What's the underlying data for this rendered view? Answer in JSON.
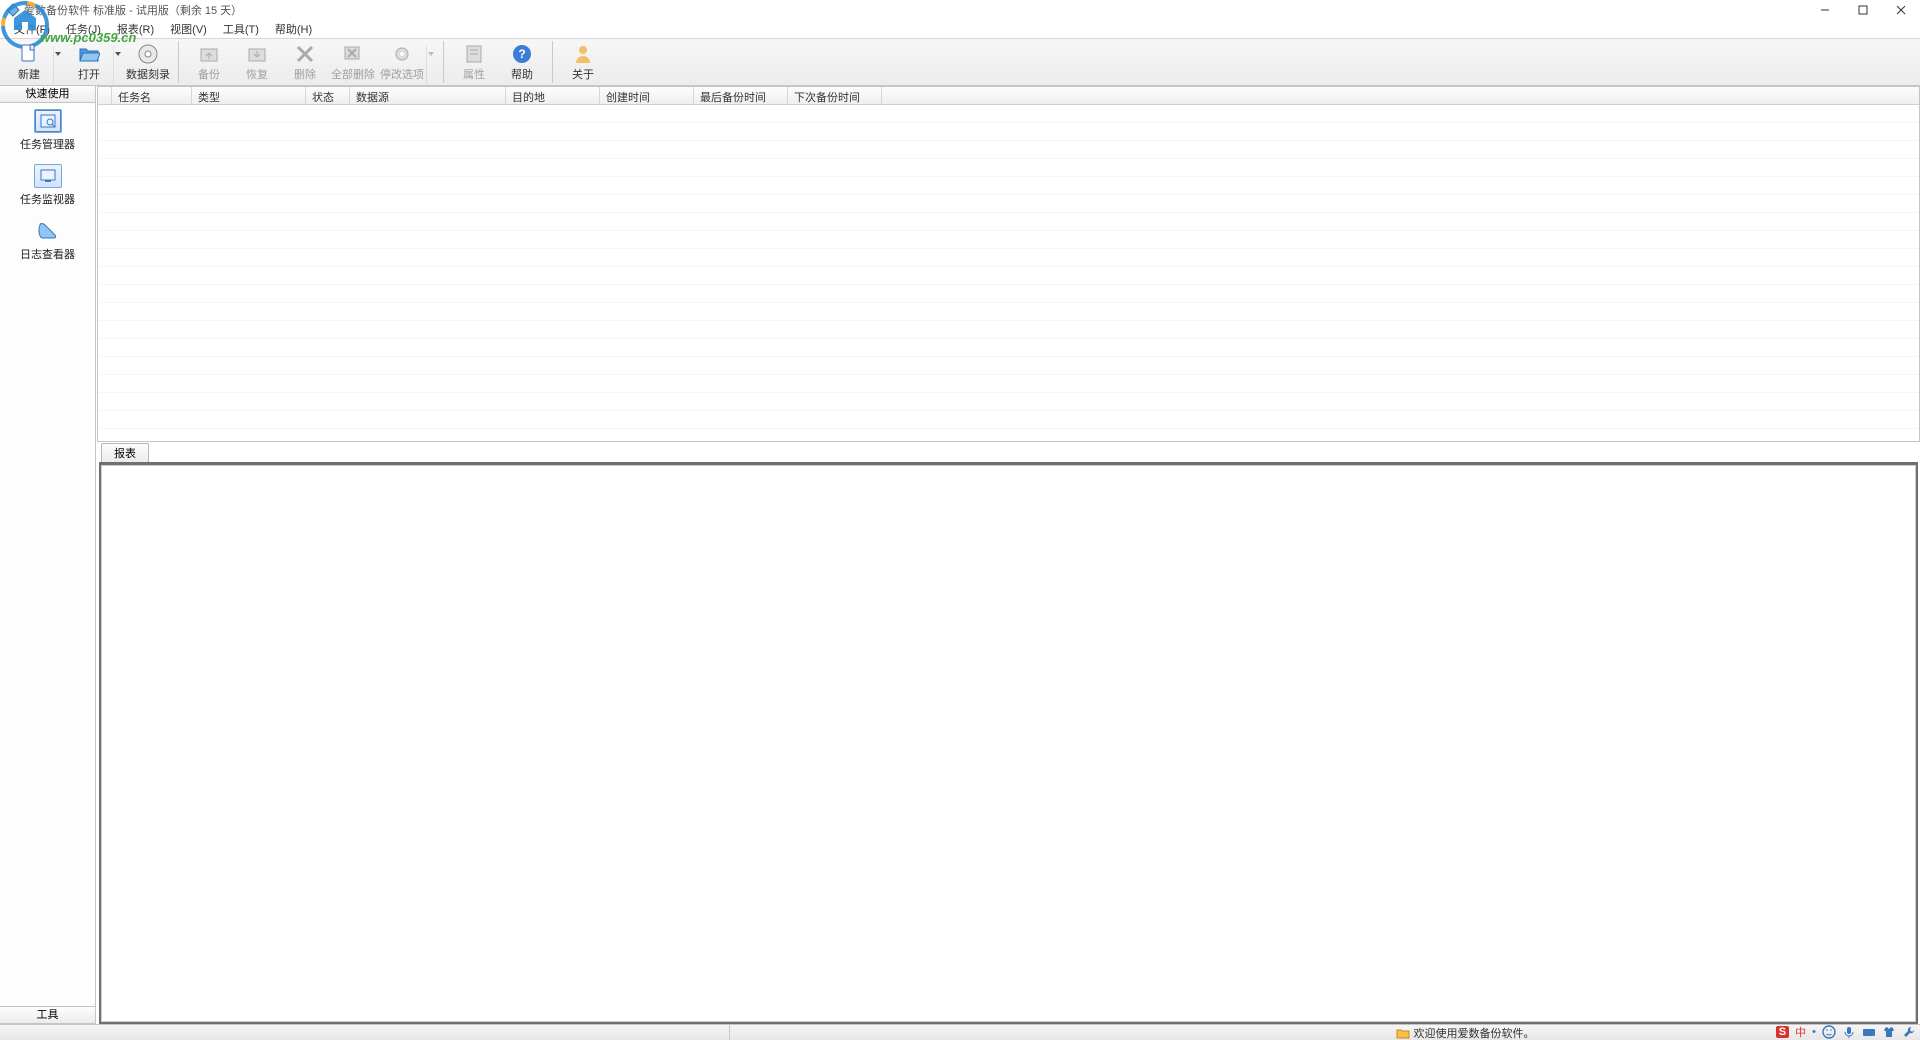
{
  "title": "爱数备份软件 标准版 - 试用版（剩余 15 天）",
  "watermark_url": "www.pc0359.cn",
  "menu": {
    "file": "文件(F)",
    "task": "任务(J)",
    "report": "报表(R)",
    "view": "视图(V)",
    "tool": "工具(T)",
    "help": "帮助(H)"
  },
  "toolbar": {
    "new": "新建",
    "open": "打开",
    "burn": "数据刻录",
    "backup": "备份",
    "restore": "恢复",
    "delete": "删除",
    "delete_all": "全部删除",
    "stop_opts": "停改选项",
    "props": "属性",
    "help": "帮助",
    "about": "关于"
  },
  "sidebar": {
    "quick": "快速使用",
    "items": [
      {
        "label": "任务管理器"
      },
      {
        "label": "任务监视器"
      },
      {
        "label": "日志查看器"
      }
    ],
    "tools": "工具"
  },
  "grid": {
    "cols": [
      "",
      "任务名",
      "类型",
      "状态",
      "数据源",
      "目的地",
      "创建时间",
      "最后备份时间",
      "下次备份时间"
    ]
  },
  "report_tab": "报表",
  "status_msg": "欢迎使用爱数备份软件。",
  "ime": "中"
}
